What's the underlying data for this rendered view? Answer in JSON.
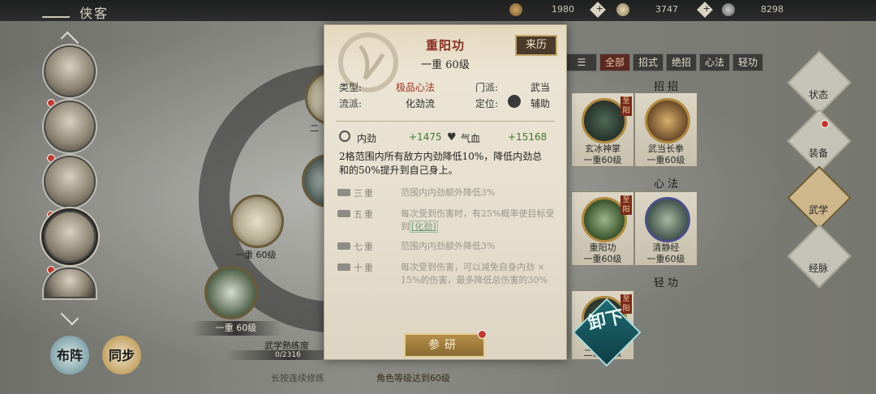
{
  "topbar": {
    "title": "侠客",
    "resources": [
      {
        "icon": "leaf-currency-icon",
        "value": "1980"
      },
      {
        "icon": "ingot-currency-icon",
        "value": "3747"
      },
      {
        "icon": "coin-currency-icon",
        "value": "8298"
      }
    ]
  },
  "left": {
    "formation_label": "布阵",
    "sync_label": "同步"
  },
  "middle": {
    "orb1_level": "一重 60级",
    "orb2_level": "一重 60级",
    "mastery_label": "武学熟练度",
    "mastery_value": "0/2316",
    "hint1": "长按连续修炼",
    "hint2": "角色等级达到60级",
    "orb_tag": "二"
  },
  "filters": [
    "全部",
    "招式",
    "绝招",
    "心法",
    "轻功"
  ],
  "sections": {
    "moves": "招招",
    "inner": "心法",
    "light": "轻功"
  },
  "cards": [
    {
      "name": "玄冰神掌",
      "level": "一重60级",
      "badge": "至阳"
    },
    {
      "name": "武当长拳",
      "level": "一重60级",
      "badge": ""
    },
    {
      "name": "重阳功",
      "level": "一重60级",
      "badge": "至阳"
    },
    {
      "name": "清静经",
      "level": "一重60级",
      "badge": ""
    },
    {
      "name": "",
      "level": "二重60级",
      "badge": "至阳"
    }
  ],
  "side_nav": [
    "状态",
    "装备",
    "武学",
    "经脉"
  ],
  "popup": {
    "title": "重阳功",
    "level": "一重 60级",
    "source_button": "来历",
    "type_key": "类型:",
    "type_val": "极品心法",
    "school_key": "门派:",
    "school_val": "武当",
    "sect_key": "流派:",
    "sect_val": "化劲流",
    "role_key": "定位:",
    "role_val": "辅助",
    "stat1_label": "内劲",
    "stat1_value": "+1475",
    "stat2_label": "气血",
    "stat2_value": "+15168",
    "description": "2格范围内所有敌方内劲降低10%，降低内劲总和的50%提升到自己身上。",
    "tiers": [
      {
        "name": "三重",
        "text": "范围内内劲额外降低3%"
      },
      {
        "name": "五重",
        "text_a": "每次受到伤害时，有25%概率使目标受到",
        "link": "[化劲]"
      },
      {
        "name": "七重",
        "text": "范围内内劲额外降低3%"
      },
      {
        "name": "十重",
        "text": "每次受到伤害，可以减免自身内劲 × 15%的伤害，最多降低总伤害的30%"
      }
    ],
    "research_button": "参研"
  },
  "unload_button": "卸下"
}
